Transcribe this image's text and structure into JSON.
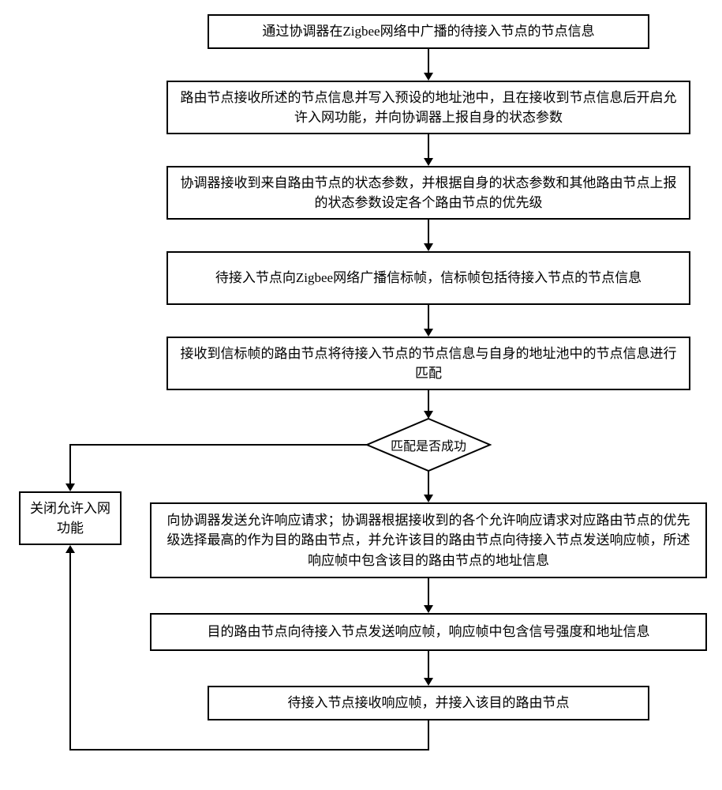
{
  "chart_data": {
    "type": "flowchart",
    "title": "",
    "nodes": [
      {
        "id": "n1",
        "type": "process",
        "text": "通过协调器在Zigbee网络中广播的待接入节点的节点信息"
      },
      {
        "id": "n2",
        "type": "process",
        "text": "路由节点接收所述的节点信息并写入预设的地址池中，且在接收到节点信息后开启允许入网功能，并向协调器上报自身的状态参数"
      },
      {
        "id": "n3",
        "type": "process",
        "text": "协调器接收到来自路由节点的状态参数，并根据自身的状态参数和其他路由节点上报的状态参数设定各个路由节点的优先级"
      },
      {
        "id": "n4",
        "type": "process",
        "text": "待接入节点向Zigbee网络广播信标帧，信标帧包括待接入节点的节点信息"
      },
      {
        "id": "n5",
        "type": "process",
        "text": "接收到信标帧的路由节点将待接入节点的节点信息与自身的地址池中的节点信息进行匹配"
      },
      {
        "id": "d1",
        "type": "decision",
        "text": "匹配是否成功"
      },
      {
        "id": "n6",
        "type": "process",
        "text": "向协调器发送允许响应请求；协调器根据接收到的各个允许响应请求对应路由节点的优先级选择最高的作为目的路由节点，并允许该目的路由节点向待接入节点发送响应帧，所述响应帧中包含该目的路由节点的地址信息"
      },
      {
        "id": "n7",
        "type": "process",
        "text": "目的路由节点向待接入节点发送响应帧，响应帧中包含信号强度和地址信息"
      },
      {
        "id": "n8",
        "type": "process",
        "text": "待接入节点接收响应帧，并接入该目的路由节点"
      },
      {
        "id": "side",
        "type": "process",
        "text": "关闭允许入网功能"
      }
    ],
    "edges": [
      {
        "from": "n1",
        "to": "n2"
      },
      {
        "from": "n2",
        "to": "n3"
      },
      {
        "from": "n3",
        "to": "n4"
      },
      {
        "from": "n4",
        "to": "n5"
      },
      {
        "from": "n5",
        "to": "d1"
      },
      {
        "from": "d1",
        "to": "n6",
        "label": ""
      },
      {
        "from": "n6",
        "to": "n7"
      },
      {
        "from": "n7",
        "to": "n8"
      },
      {
        "from": "n8",
        "to": "side"
      },
      {
        "from": "side",
        "to": "d1"
      }
    ]
  }
}
